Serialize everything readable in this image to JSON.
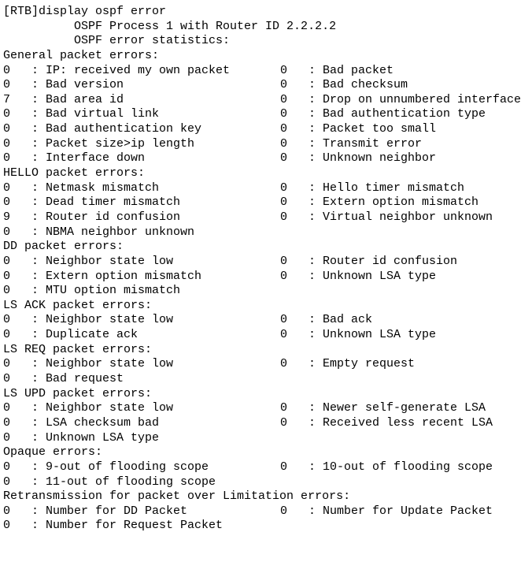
{
  "terminal": {
    "prompt_line": "[RTB]display ospf error",
    "header_lines": [
      "          OSPF Process 1 with Router ID 2.2.2.2",
      "          OSPF error statistics:"
    ],
    "sections": [
      {
        "title": "General packet errors:",
        "rows": [
          {
            "left_count": "0",
            "left_label": "IP: received my own packet",
            "right_count": "0",
            "right_label": "Bad packet"
          },
          {
            "left_count": "0",
            "left_label": "Bad version",
            "right_count": "0",
            "right_label": "Bad checksum"
          },
          {
            "left_count": "7",
            "left_label": "Bad area id",
            "right_count": "0",
            "right_label": "Drop on unnumbered interface"
          },
          {
            "left_count": "0",
            "left_label": "Bad virtual link",
            "right_count": "0",
            "right_label": "Bad authentication type"
          },
          {
            "left_count": "0",
            "left_label": "Bad authentication key",
            "right_count": "0",
            "right_label": "Packet too small"
          },
          {
            "left_count": "0",
            "left_label": "Packet size>ip length",
            "right_count": "0",
            "right_label": "Transmit error"
          },
          {
            "left_count": "0",
            "left_label": "Interface down",
            "right_count": "0",
            "right_label": "Unknown neighbor"
          }
        ]
      },
      {
        "title": "HELLO packet errors:",
        "rows": [
          {
            "left_count": "0",
            "left_label": "Netmask mismatch",
            "right_count": "0",
            "right_label": "Hello timer mismatch"
          },
          {
            "left_count": "0",
            "left_label": "Dead timer mismatch",
            "right_count": "0",
            "right_label": "Extern option mismatch"
          },
          {
            "left_count": "9",
            "left_label": "Router id confusion",
            "right_count": "0",
            "right_label": "Virtual neighbor unknown"
          },
          {
            "left_count": "0",
            "left_label": "NBMA neighbor unknown",
            "right_count": "",
            "right_label": ""
          }
        ]
      },
      {
        "title": "DD packet errors:",
        "rows": [
          {
            "left_count": "0",
            "left_label": "Neighbor state low",
            "right_count": "0",
            "right_label": "Router id confusion"
          },
          {
            "left_count": "0",
            "left_label": "Extern option mismatch",
            "right_count": "0",
            "right_label": "Unknown LSA type"
          },
          {
            "left_count": "0",
            "left_label": "MTU option mismatch",
            "right_count": "",
            "right_label": ""
          }
        ]
      },
      {
        "title": "LS ACK packet errors:",
        "rows": [
          {
            "left_count": "0",
            "left_label": "Neighbor state low",
            "right_count": "0",
            "right_label": "Bad ack"
          },
          {
            "left_count": "0",
            "left_label": "Duplicate ack",
            "right_count": "0",
            "right_label": "Unknown LSA type"
          }
        ]
      },
      {
        "title": "LS REQ packet errors:",
        "rows": [
          {
            "left_count": "0",
            "left_label": "Neighbor state low",
            "right_count": "0",
            "right_label": "Empty request"
          },
          {
            "left_count": "0",
            "left_label": "Bad request",
            "right_count": "",
            "right_label": ""
          }
        ]
      },
      {
        "title": "LS UPD packet errors:",
        "rows": [
          {
            "left_count": "0",
            "left_label": "Neighbor state low",
            "right_count": "0",
            "right_label": "Newer self-generate LSA"
          },
          {
            "left_count": "0",
            "left_label": "LSA checksum bad",
            "right_count": "0",
            "right_label": "Received less recent LSA"
          },
          {
            "left_count": "0",
            "left_label": "Unknown LSA type",
            "right_count": "",
            "right_label": ""
          }
        ]
      },
      {
        "title": "Opaque errors:",
        "rows": [
          {
            "left_count": "0",
            "left_label": "9-out of flooding scope",
            "right_count": "0",
            "right_label": "10-out of flooding scope"
          },
          {
            "left_count": "0",
            "left_label": "11-out of flooding scope",
            "right_count": "",
            "right_label": ""
          }
        ]
      },
      {
        "title": "Retransmission for packet over Limitation errors:",
        "rows": [
          {
            "left_count": "0",
            "left_label": "Number for DD Packet",
            "right_count": "0",
            "right_label": "Number for Update Packet"
          },
          {
            "left_count": "0",
            "left_label": "Number for Request Packet",
            "right_count": "",
            "right_label": ""
          }
        ]
      }
    ]
  }
}
